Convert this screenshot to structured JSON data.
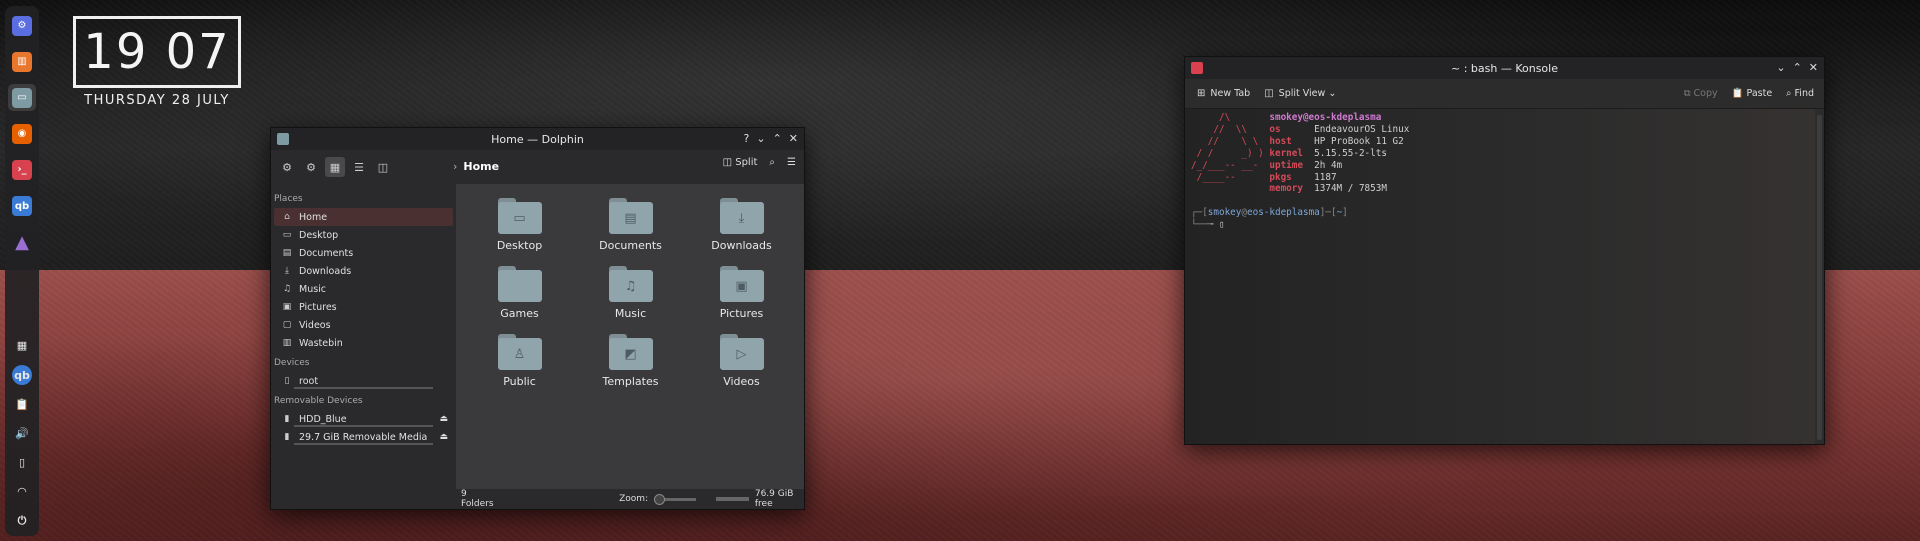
{
  "clock": {
    "time": "19 07",
    "date": "THURSDAY  28 JULY"
  },
  "dock": {
    "items": [
      {
        "name": "app-launcher-icon",
        "color": "#5b6ee1",
        "glyph": "⚙"
      },
      {
        "name": "htop-app-icon",
        "color": "#e8762c",
        "glyph": "▥"
      },
      {
        "name": "dolphin-app-icon",
        "color": "#7e9aa3",
        "glyph": "▭",
        "active": true
      },
      {
        "name": "firefox-app-icon",
        "color": "#e66000",
        "glyph": "◉"
      },
      {
        "name": "konsole-app-icon",
        "color": "#d8424e",
        "glyph": "›_"
      },
      {
        "name": "qbittorrent-app-icon",
        "color": "#3a7bd5",
        "glyph": "qb"
      },
      {
        "name": "endeavour-app-icon",
        "color": "#9a6fd3",
        "glyph": "▲"
      }
    ],
    "tray": [
      {
        "name": "firewall-tray-icon",
        "glyph": "▦"
      },
      {
        "name": "qbittorrent-tray-icon",
        "glyph": "qb"
      },
      {
        "name": "clipboard-tray-icon",
        "glyph": "📋"
      },
      {
        "name": "volume-tray-icon",
        "glyph": "🔊"
      },
      {
        "name": "device-tray-icon",
        "glyph": "▯"
      },
      {
        "name": "wifi-tray-icon",
        "glyph": "◠"
      },
      {
        "name": "power-tray-icon",
        "glyph": "⏻"
      }
    ]
  },
  "dolphin": {
    "title": "Home — Dolphin",
    "help": "?",
    "breadcrumb": "Home",
    "split_label": "Split",
    "places_header": "Places",
    "places": [
      {
        "label": "Home",
        "icon": "⌂",
        "icon_name": "home-icon",
        "selected": true
      },
      {
        "label": "Desktop",
        "icon": "▭",
        "icon_name": "desktop-icon"
      },
      {
        "label": "Documents",
        "icon": "▤",
        "icon_name": "documents-icon"
      },
      {
        "label": "Downloads",
        "icon": "⤓",
        "icon_name": "downloads-icon"
      },
      {
        "label": "Music",
        "icon": "♫",
        "icon_name": "music-icon"
      },
      {
        "label": "Pictures",
        "icon": "▣",
        "icon_name": "pictures-icon"
      },
      {
        "label": "Videos",
        "icon": "▢",
        "icon_name": "videos-icon"
      },
      {
        "label": "Wastebin",
        "icon": "▥",
        "icon_name": "wastebin-icon"
      }
    ],
    "devices_header": "Devices",
    "devices": [
      {
        "label": "root",
        "icon": "▯",
        "icon_name": "drive-icon"
      }
    ],
    "removable_header": "Removable Devices",
    "removable": [
      {
        "label": "HDD_Blue",
        "icon": "▮",
        "icon_name": "hdd-icon"
      },
      {
        "label": "29.7 GiB Removable Media",
        "icon": "▮",
        "icon_name": "removable-media-icon"
      }
    ],
    "folders": [
      {
        "label": "Desktop",
        "glyph": "▭",
        "icon_name": "desktop-folder-icon"
      },
      {
        "label": "Documents",
        "glyph": "▤",
        "icon_name": "documents-folder-icon"
      },
      {
        "label": "Downloads",
        "glyph": "⤓",
        "icon_name": "downloads-folder-icon"
      },
      {
        "label": "Games",
        "glyph": "",
        "icon_name": "games-folder-icon"
      },
      {
        "label": "Music",
        "glyph": "♫",
        "icon_name": "music-folder-icon"
      },
      {
        "label": "Pictures",
        "glyph": "▣",
        "icon_name": "pictures-folder-icon"
      },
      {
        "label": "Public",
        "glyph": "♙",
        "icon_name": "public-folder-icon"
      },
      {
        "label": "Templates",
        "glyph": "◩",
        "icon_name": "templates-folder-icon"
      },
      {
        "label": "Videos",
        "glyph": "▷",
        "icon_name": "videos-folder-icon"
      }
    ],
    "status": {
      "count": "9 Folders",
      "zoom_label": "Zoom:",
      "free": "76.9 GiB free"
    }
  },
  "konsole": {
    "title": "~ : bash — Konsole",
    "new_tab": "New Tab",
    "split_view": "Split View",
    "copy": "Copy",
    "paste": "Paste",
    "find": "Find",
    "fetch": {
      "logo": [
        "     /\\",
        "    //  \\\\",
        "   //    \\ \\",
        " / /     _) )",
        "/_/___-- __-",
        " /____--",
        ""
      ],
      "user": "smokey@eos-kdeplasma",
      "rows": [
        {
          "key": "os",
          "value": "EndeavourOS Linux"
        },
        {
          "key": "host",
          "value": "HP ProBook 11 G2"
        },
        {
          "key": "kernel",
          "value": "5.15.55-2-lts"
        },
        {
          "key": "uptime",
          "value": "2h 4m"
        },
        {
          "key": "pkgs",
          "value": "1187"
        },
        {
          "key": "memory",
          "value": "1374M / 7853M"
        }
      ]
    },
    "prompt": {
      "open": "┌─[",
      "user": "smokey",
      "at": "@",
      "host": "eos-kdeplasma",
      "mid": "]─[",
      "cwd": "~",
      "close": "]",
      "line2": "└──╼ ",
      "cursor": "▯"
    }
  }
}
